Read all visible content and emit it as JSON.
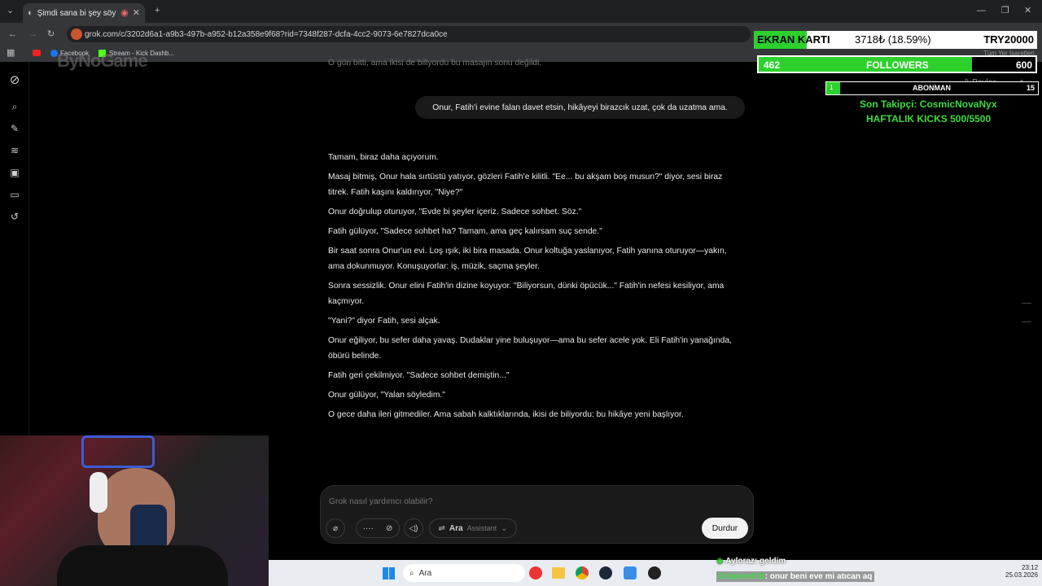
{
  "browser": {
    "tab_title": "Şimdi sana bi şey söylicem",
    "url": "grok.com/c/3202d6a1-a9b3-497b-a952-b12a358e9f68?rid=7348f287-dcfa-4cc2-9073-6e7827dca0ce",
    "bookmarks": [
      "Facebook",
      "Stream - Kick Dashb..."
    ],
    "bookmark_right": "Tüm Yer İşaretleri"
  },
  "watermark": "ByNoGame",
  "share_label": "Paylaş",
  "user_message": "Onur, Fatih'i evine falan davet etsin, hikâyeyi birazcık uzat, çok da uzatma ama.",
  "top_cut_text": "O gün bitti, ama ikisi de biliyordu bu masajın sonu değildi.",
  "assistant_paragraphs": [
    "Tamam, biraz daha açıyorum.",
    "Masaj bitmiş, Onur hala sırtüstü yatıyor, gözleri Fatih'e kilitli. \"Ee... bu akşam boş musun?\" diyor, sesi biraz titrek. Fatih kaşını kaldırıyor, \"Niye?\"",
    "Onur doğrulup oturuyor, \"Evde bi şeyler içeriz. Sadece sohbet. Söz.\"",
    "Fatih gülüyor, \"Sadece sohbet ha? Tamam, ama geç kalırsam suç sende.\"",
    "Bir saat sonra Onur'un evi. Loş ışık, iki bira masada. Onur koltuğa yaslanıyor, Fatih yanına oturuyor—yakın, ama dokunmuyor. Konuşuyorlar: iş, müzik, saçma şeyler.",
    "Sonra sessizlik. Onur elini Fatih'in dizine koyuyor. \"Biliyorsun, dünki öpücük...\" Fatih'in nefesi kesiliyor, ama kaçmıyor.",
    "\"Yani?\" diyor Fatih, sesi alçak.",
    "Onur eğiliyor, bu sefer daha yavaş. Dudaklar yine buluşuyor—ama bu sefer acele yok. Eli Fatih'in yanağında, öbürü belinde.",
    "Fatih geri çekilmiyor. \"Sadece sohbet demiştin...\"",
    "Onur gülüyor, \"Yalan söyledim.\"",
    "O gece daha ileri gitmediler. Ama sabah kalktıklarında, ikisi de biliyordu: bu hikâye yeni başlıyor."
  ],
  "composer": {
    "placeholder": "Grok nasıl yardımcı olabilir?",
    "mode_label": "Ara",
    "mode_sub": "Assistant",
    "stop_label": "Durdur"
  },
  "overlay": {
    "gpu_label": "EKRAN KARTI",
    "gpu_progress": "3718₺ (18.59%)",
    "gpu_goal": "TRY20000",
    "gpu_fraction": 0.1859,
    "followers_current": "462",
    "followers_label": "FOLLOWERS",
    "followers_goal": "600",
    "followers_fraction": 0.77,
    "sub_current": "1",
    "sub_label": "ABONMAN",
    "sub_goal": "15",
    "sub_fraction": 0.0667,
    "last_follower": "Son Takipçi: CosmicNovaNyx",
    "kicks": "HAFTALIK KICKS 500/5500"
  },
  "chat_overlay": [
    {
      "user": "Ayloraz",
      "text": ": geldim"
    },
    {
      "user": "Delpiero010",
      "text": ": onur beni eve mi atıcan aq"
    }
  ],
  "taskbar": {
    "search": "Ara",
    "time": "23:12",
    "date": "25.03.2026"
  }
}
